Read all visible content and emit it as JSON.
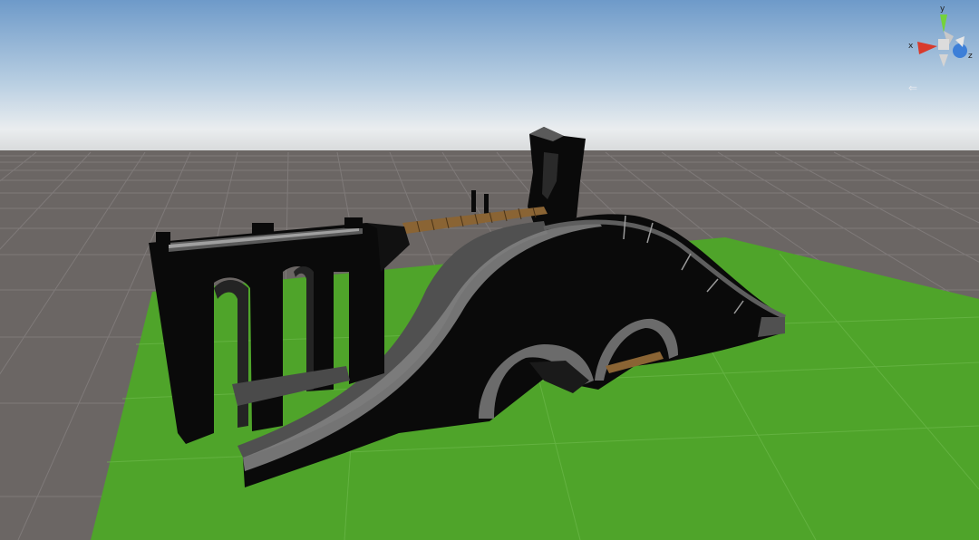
{
  "viewport": {
    "sky_top_color": "#6e9ac9",
    "sky_horizon_color": "#eaedef",
    "ground_color": "#6b6664",
    "plane_color": "#4fa42a",
    "object_color": "#0a0a0a",
    "highlight_color": "#7f7f7f",
    "plank_color": "#8a6434"
  },
  "gizmo": {
    "y_label": "y",
    "x_label": "x",
    "z_label": "z",
    "y_color": "#74d23b",
    "x_color": "#d83a2c",
    "z_color": "#3c7fd8"
  },
  "projection": {
    "mode_label": "",
    "arrow": "⇐"
  }
}
